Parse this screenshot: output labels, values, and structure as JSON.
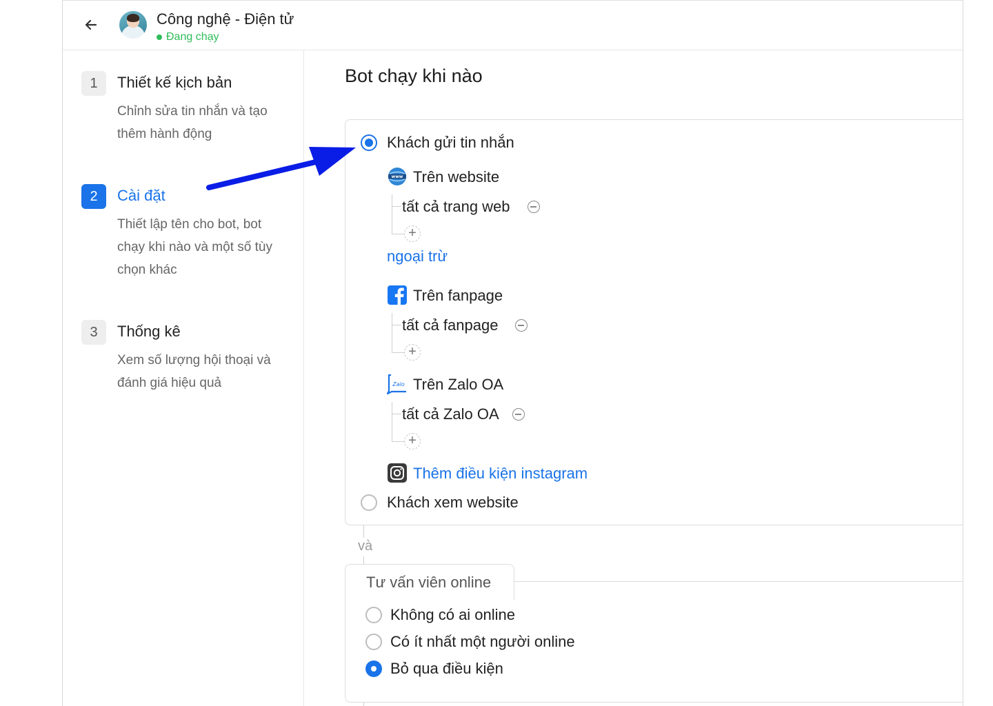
{
  "header": {
    "bot_name": "Công nghệ - Điện tử",
    "status": "Đang chạy"
  },
  "sidebar": {
    "steps": [
      {
        "number": "1",
        "title": "Thiết kế kịch bản",
        "description": "Chỉnh sửa tin nhắn và tạo thêm hành động",
        "active": false
      },
      {
        "number": "2",
        "title": "Cài đặt",
        "description": "Thiết lập tên cho bot, bot chạy khi nào và một số tùy chọn khác",
        "active": true
      },
      {
        "number": "3",
        "title": "Thống kê",
        "description": "Xem số lượng hội thoại và đánh giá hiệu quả",
        "active": false
      }
    ]
  },
  "main": {
    "title": "Bot chạy khi nào",
    "trigger": {
      "option_message": "Khách gửi tin nhắn",
      "option_view_website": "Khách xem website",
      "selected": "option_message",
      "website": {
        "label": "Trên website",
        "condition": "tất cả trang web",
        "except_link": "ngoại trừ"
      },
      "fanpage": {
        "label": "Trên fanpage",
        "condition": "tất cả fanpage"
      },
      "zalo": {
        "label": "Trên Zalo OA",
        "condition": "tất cả Zalo OA",
        "icon_text": "Zalo"
      },
      "instagram": {
        "add_link": "Thêm điều kiện instagram"
      }
    },
    "connector": "và",
    "advisor": {
      "title": "Tư vấn viên online",
      "options": [
        {
          "label": "Không có ai online",
          "selected": false
        },
        {
          "label": "Có ít nhất một người online",
          "selected": false
        },
        {
          "label": "Bỏ qua điều kiện",
          "selected": true
        }
      ]
    }
  },
  "colors": {
    "accent": "#1a73e8",
    "status_green": "#2ebd59",
    "annotation_arrow": "#0a1de6"
  }
}
